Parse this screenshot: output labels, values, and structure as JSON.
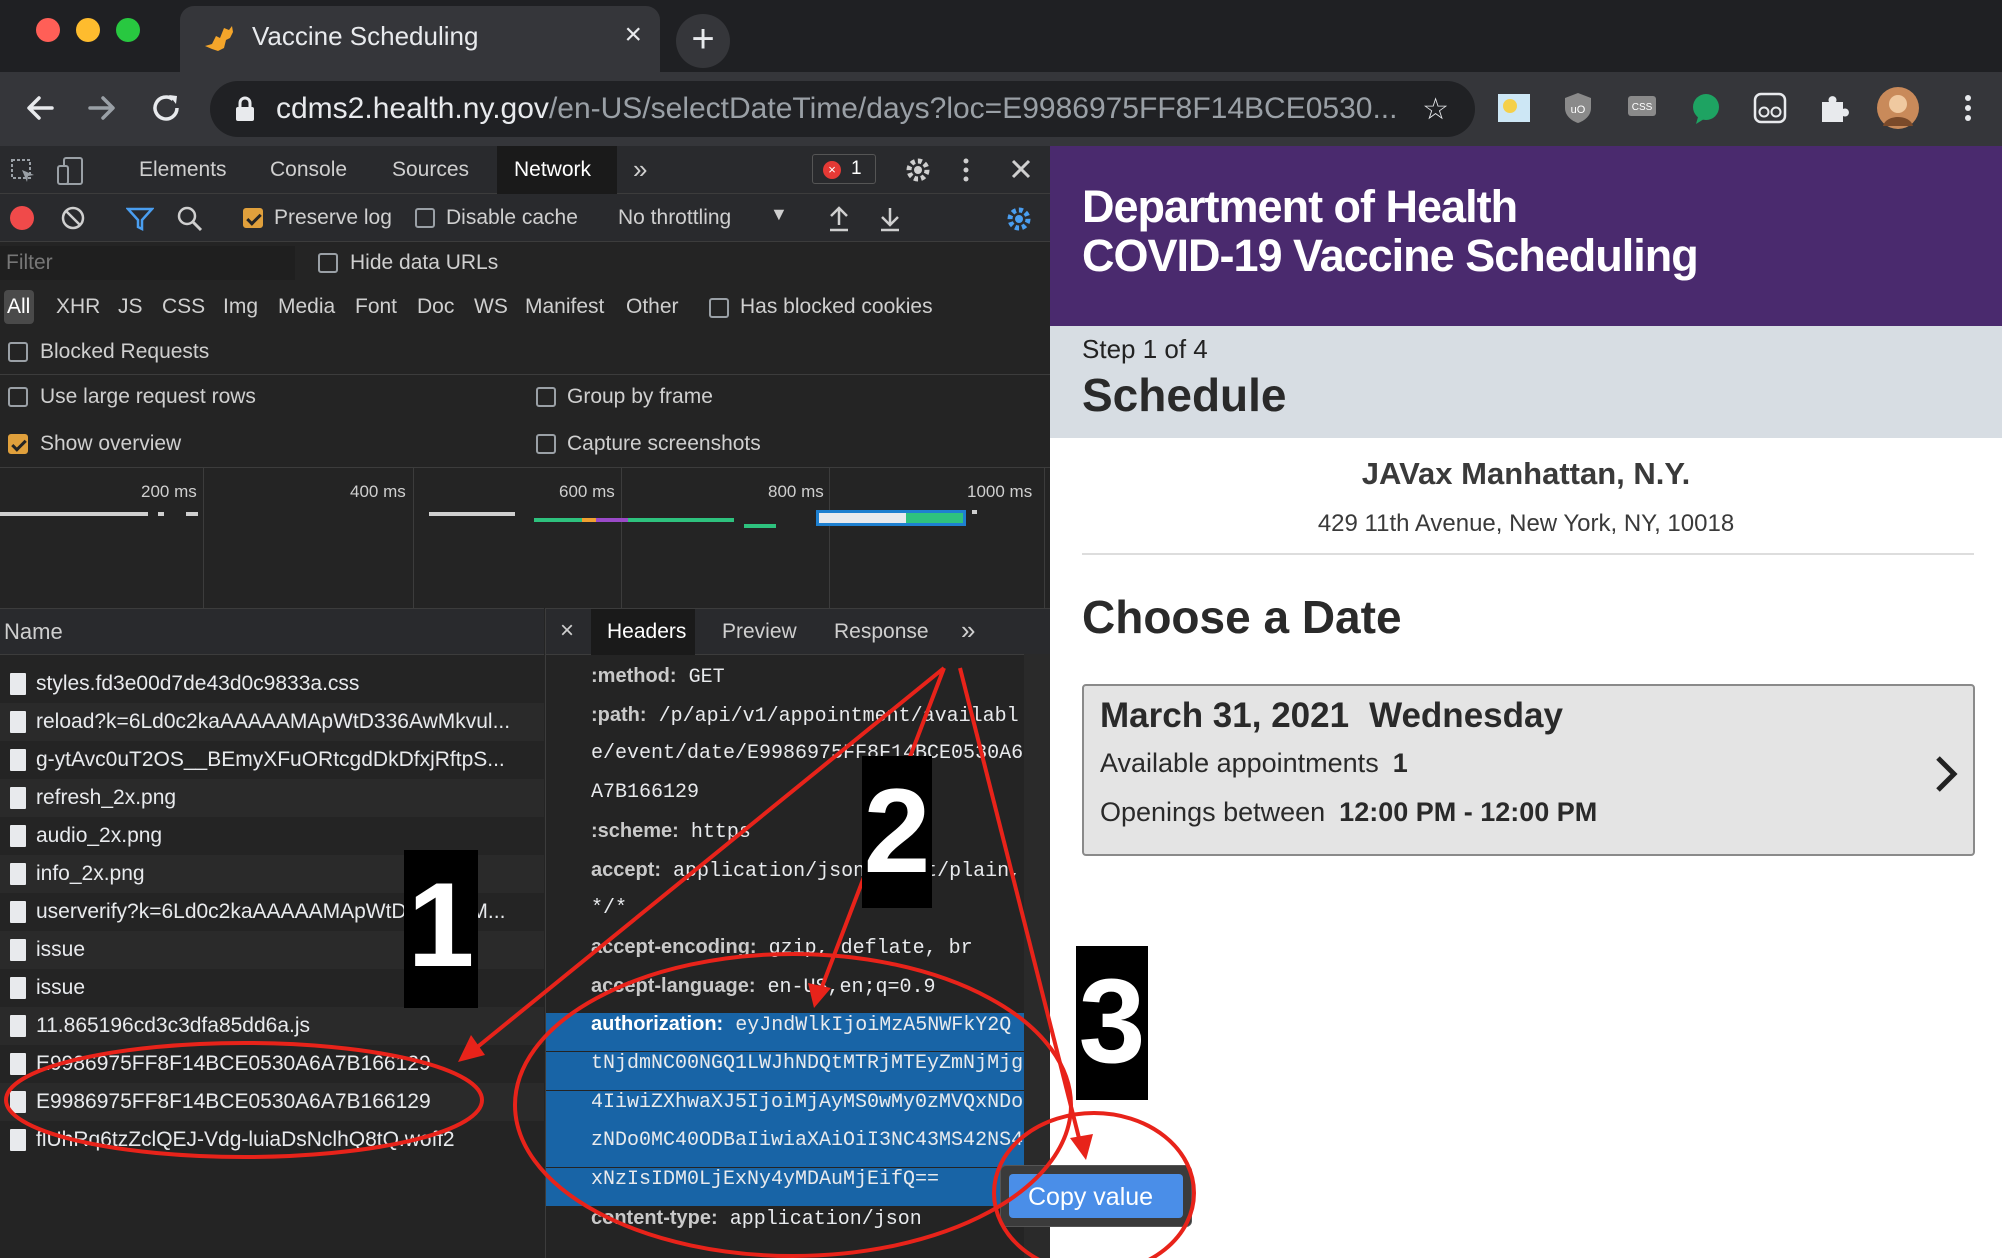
{
  "browser": {
    "tab_title": "Vaccine Scheduling",
    "url_host": "cdms2.health.ny.gov",
    "url_rest": "/en-US/selectDateTime/days?loc=E9986975FF8F14BCE0530...",
    "colors": {
      "close": "#ff5f57",
      "minimize": "#febc2e",
      "maximize": "#28c840"
    }
  },
  "devtools": {
    "tabs": [
      "Elements",
      "Console",
      "Sources",
      "Network"
    ],
    "active_tab": "Network",
    "more_tabs": "»",
    "error_count": "1",
    "toolbar": {
      "preserve_log": "Preserve log",
      "disable_cache": "Disable cache",
      "throttling": "No throttling"
    },
    "filter_placeholder": "Filter",
    "hide_data_urls": "Hide data URLs",
    "types": [
      "All",
      "XHR",
      "JS",
      "CSS",
      "Img",
      "Media",
      "Font",
      "Doc",
      "WS",
      "Manifest",
      "Other"
    ],
    "has_blocked_cookies": "Has blocked cookies",
    "blocked_requests": "Blocked Requests",
    "settings": {
      "large_rows": "Use large request rows",
      "group_by_frame": "Group by frame",
      "show_overview": "Show overview",
      "capture_screenshots": "Capture screenshots"
    },
    "overview_ticks": [
      "200 ms",
      "400 ms",
      "600 ms",
      "800 ms",
      "1000 ms"
    ],
    "name_column": "Name",
    "requests": [
      "styles.fd3e00d7de43d0c9833a.css",
      "reload?k=6Ld0c2kaAAAAAMApWtD336AwMkvul...",
      "g-ytAvc0uT2OS__BEmyXFuORtcgdDkDfxjRftpS...",
      "refresh_2x.png",
      "audio_2x.png",
      "info_2x.png",
      "userverify?k=6Ld0c2kaAAAAAMApWtD336AwM...",
      "issue",
      "issue",
      "11.865196cd3c3dfa85dd6a.js",
      "E9986975FF8F14BCE0530A6A7B166129",
      "E9986975FF8F14BCE0530A6A7B166129",
      "flUhRq6tzZclQEJ-Vdg-luiaDsNclhQ8tQ.woff2"
    ],
    "detail_tabs": {
      "close": "×",
      "headers": "Headers",
      "preview": "Preview",
      "response": "Response",
      "more": "»"
    },
    "header_lines": [
      {
        "k": ":method:",
        "v": "GET"
      },
      {
        "k": ":path:",
        "v": "/p/api/v1/appointment/availabl"
      },
      {
        "k": "",
        "v": "e/event/date/E9986975FF8F14BCE0530A6"
      },
      {
        "k": "",
        "v": "A7B166129"
      },
      {
        "k": ":scheme:",
        "v": "https"
      },
      {
        "k": "accept:",
        "v": "application/json, text/plain,"
      },
      {
        "k": "",
        "v": "*/*"
      },
      {
        "k": "accept-encoding:",
        "v": "gzip, deflate, br"
      },
      {
        "k": "accept-language:",
        "v": "en-US,en;q=0.9"
      },
      {
        "k": "authorization:",
        "v": "eyJndWlkIjoiMzA5NWFkY2Q"
      },
      {
        "k": "",
        "v": "tNjdmNC00NGQ1LWJhNDQtMTRjMTEyZmNjMjg"
      },
      {
        "k": "",
        "v": "4IiwiZXhwaXJ5IjoiMjAyMS0wMy0zMVQxNDo"
      },
      {
        "k": "",
        "v": "zNDo0MC40ODBaIiwiaXAiOiI3NC43MS42NS4"
      },
      {
        "k": "",
        "v": "xNzIsIDM0LjExNy4yMDAuMjEifQ=="
      },
      {
        "k": "content-type:",
        "v": "application/json"
      }
    ],
    "context_menu": "Copy value"
  },
  "page": {
    "banner_line1": "Department of Health",
    "banner_line2": "COVID-19 Vaccine Scheduling",
    "step_label": "Step 1 of 4",
    "step_title": "Schedule",
    "location_name": "JAVax Manhattan, N.Y.",
    "location_address": "429 11th Avenue, New York, NY, 10018",
    "choose_heading": "Choose a Date",
    "date_card": {
      "date": "March 31, 2021",
      "weekday": "Wednesday",
      "available_label": "Available appointments",
      "available_value": "1",
      "openings_label": "Openings between",
      "openings_value": "12:00 PM - 12:00 PM"
    },
    "brand_color": "#4a2a6e"
  },
  "annotations": [
    "1",
    "2",
    "3"
  ]
}
